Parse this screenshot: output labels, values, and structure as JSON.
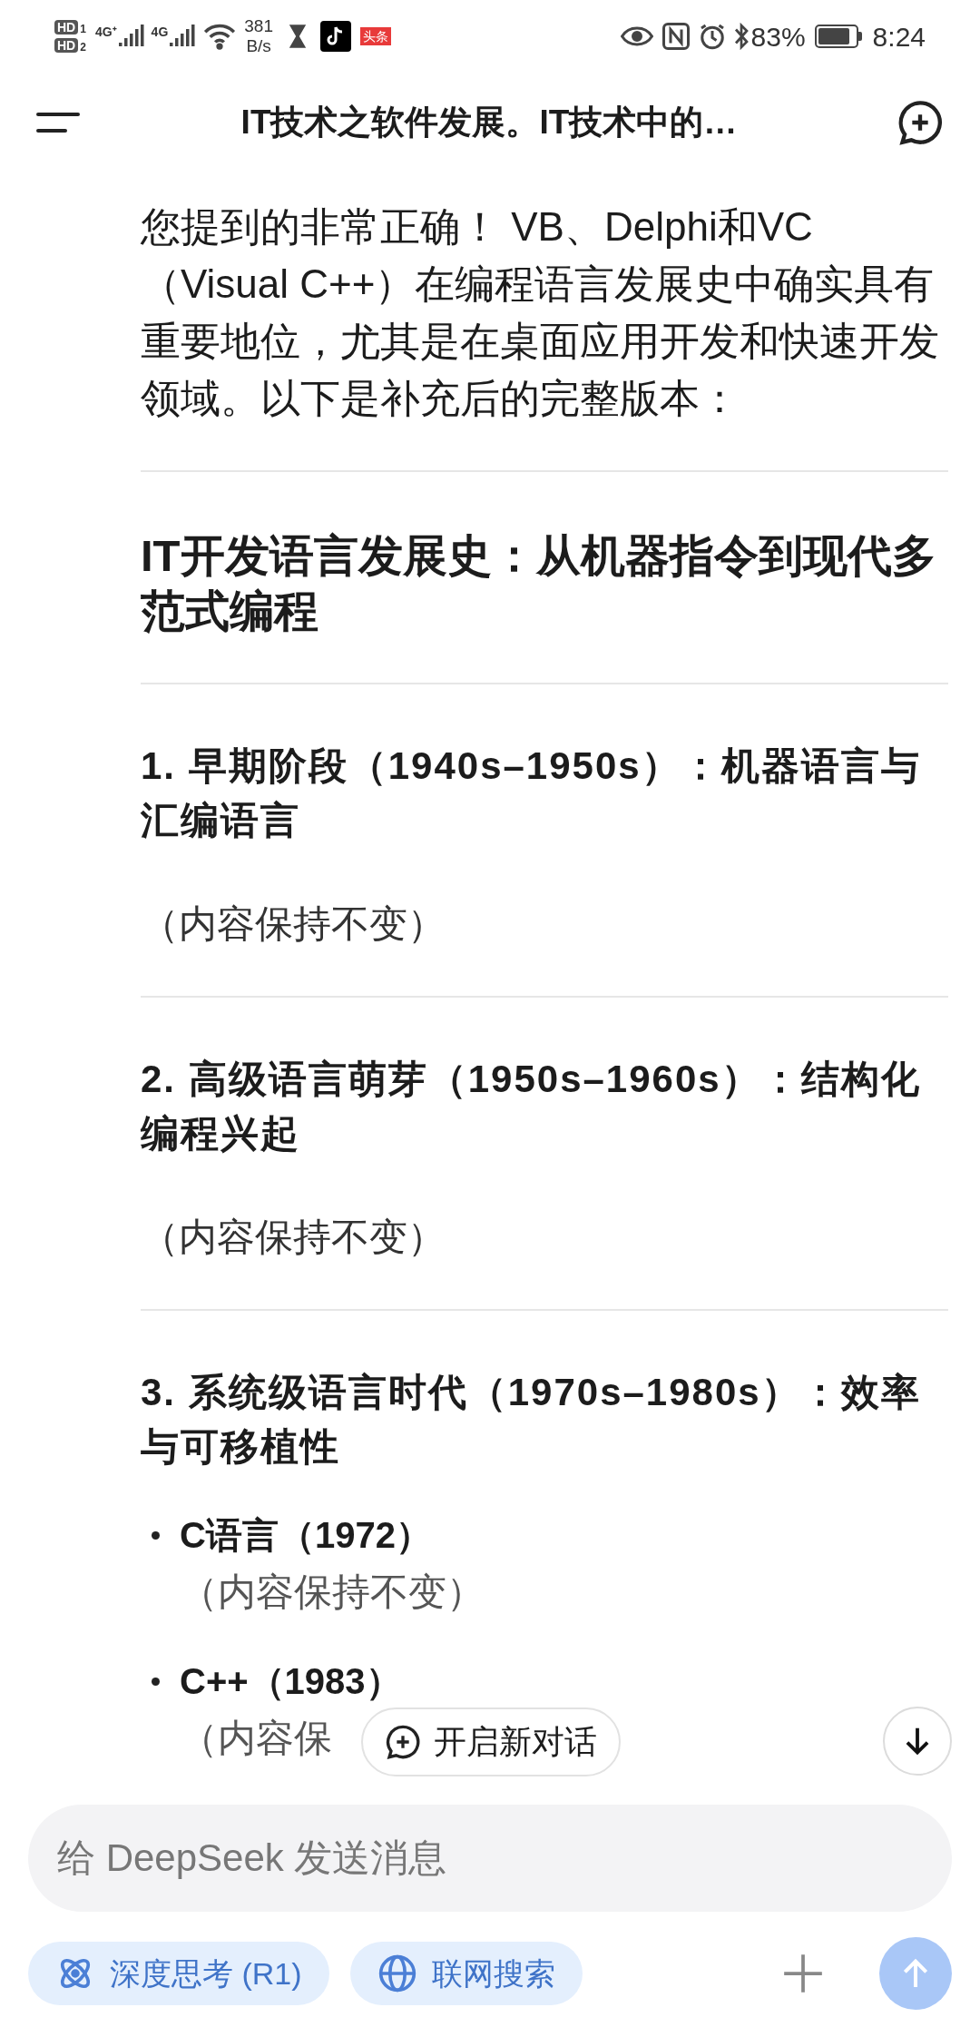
{
  "status_bar": {
    "sim_labels": [
      {
        "label": "HD",
        "slot": "1"
      },
      {
        "label": "HD",
        "slot": "2"
      }
    ],
    "networks": [
      "4G⁺",
      "4G"
    ],
    "speed_value": "381",
    "speed_unit": "B/s",
    "app_badge": "头条",
    "battery_percent": "83%",
    "time": "8:24"
  },
  "header": {
    "title": "IT技术之软件发展。IT技术中的…"
  },
  "content": [
    {
      "kind": "paragraph",
      "text": "您提到的非常正确！ VB、Delphi和VC（Visual C++）在编程语言发展史中确实具有重要地位，尤其是在桌面应用开发和快速开发领域。以下是补充后的完整版本："
    },
    {
      "kind": "divider"
    },
    {
      "kind": "title",
      "text": "IT开发语言发展史：从机器指令到现代多范式编程"
    },
    {
      "kind": "divider"
    },
    {
      "kind": "heading",
      "text": "1. 早期阶段（1940s–1950s）：机器语言与汇编语言"
    },
    {
      "kind": "note",
      "text": "（内容保持不变）"
    },
    {
      "kind": "divider"
    },
    {
      "kind": "heading",
      "text": "2. 高级语言萌芽（1950s–1960s）：结构化编程兴起"
    },
    {
      "kind": "note",
      "text": "（内容保持不变）"
    },
    {
      "kind": "divider"
    },
    {
      "kind": "heading",
      "text": "3. 系统级语言时代（1970s–1980s）：效率与可移植性"
    },
    {
      "kind": "bullet",
      "title": "C语言（1972）",
      "text": "（内容保持不变）"
    },
    {
      "kind": "bullet",
      "title": "C++（1983）",
      "text": "（内容保"
    }
  ],
  "new_chat_button": {
    "label": "开启新对话"
  },
  "composer": {
    "placeholder": "给 DeepSeek 发送消息",
    "toggles": [
      {
        "label": "深度思考 (R1)",
        "kind": "think"
      },
      {
        "label": "联网搜索",
        "kind": "search"
      }
    ]
  }
}
